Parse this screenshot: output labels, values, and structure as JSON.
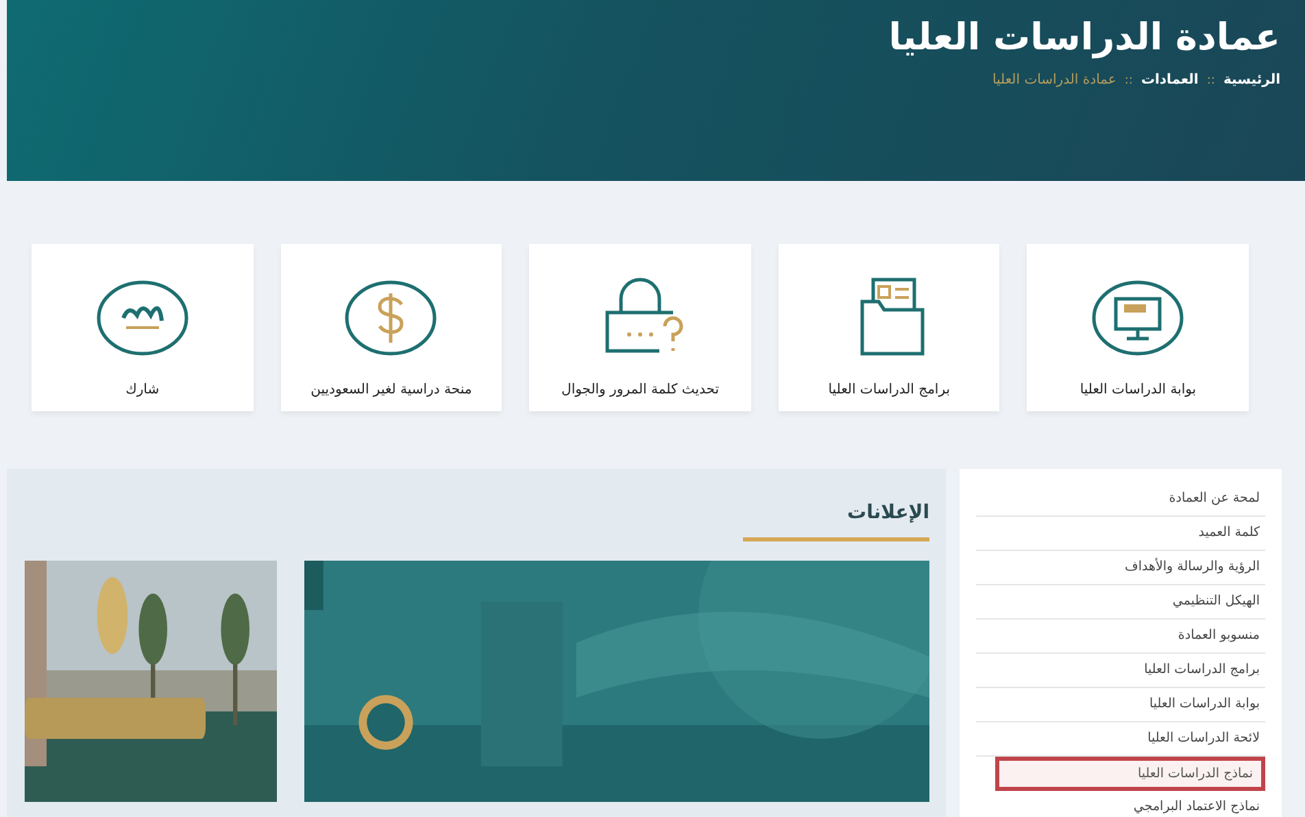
{
  "header": {
    "title": "عمادة الدراسات العليا",
    "breadcrumb": [
      {
        "label": "الرئيسية",
        "current": false
      },
      {
        "label": "العمادات",
        "current": false
      },
      {
        "label": "عمادة الدراسات العليا",
        "current": true
      }
    ],
    "separator": "::"
  },
  "services": [
    {
      "label": "بوابة الدراسات العليا",
      "kind": "monitor"
    },
    {
      "label": "برامج الدراسات العليا",
      "kind": "folder"
    },
    {
      "label": "تحديث كلمة المرور والجوال",
      "kind": "lock"
    },
    {
      "label": "منحة دراسية لغير السعوديين",
      "kind": "dollar"
    },
    {
      "label": "شارك",
      "kind": "logo"
    }
  ],
  "announcements": {
    "title": "الإعلانات"
  },
  "sidebar": {
    "items": [
      {
        "label": "لمحة عن العمادة",
        "highlighted": false
      },
      {
        "label": "كلمة العميد",
        "highlighted": false
      },
      {
        "label": "الرؤية والرسالة والأهداف",
        "highlighted": false
      },
      {
        "label": "الهيكل التنظيمي",
        "highlighted": false
      },
      {
        "label": "منسوبو العمادة",
        "highlighted": false
      },
      {
        "label": "برامج الدراسات العليا",
        "highlighted": false
      },
      {
        "label": "بوابة الدراسات العليا",
        "highlighted": false
      },
      {
        "label": "لائحة الدراسات العليا",
        "highlighted": false
      },
      {
        "label": "نماذج الدراسات العليا",
        "highlighted": true
      },
      {
        "label": "نماذج الاعتماد البرامجي",
        "highlighted": false
      }
    ]
  }
}
